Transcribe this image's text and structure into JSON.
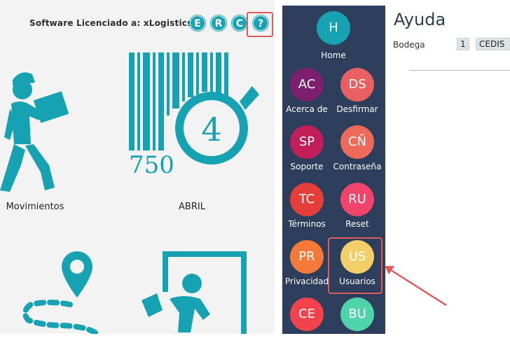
{
  "license_text": "Software Licenciado a: xLogistics",
  "top_buttons": [
    "E",
    "R",
    "C",
    "?"
  ],
  "tiles": [
    {
      "label": "Movimientos",
      "icon": "delivery-man-icon"
    },
    {
      "label": "ABRIL",
      "icon": "barcode-number-icon",
      "barcode_text": "750",
      "number_text": "4"
    },
    {
      "label": "",
      "icon": "route-pin-icon"
    },
    {
      "label": "",
      "icon": "door-person-icon"
    }
  ],
  "sidebar": {
    "home": {
      "initials": "H",
      "label": "Home",
      "color": "#17a2b3"
    },
    "items": [
      {
        "initials": "AC",
        "label": "Acerca de",
        "color": "#7b1f6e"
      },
      {
        "initials": "DS",
        "label": "Desfirmar",
        "color": "#e8605f"
      },
      {
        "initials": "SP",
        "label": "Soporte",
        "color": "#c21e5a"
      },
      {
        "initials": "CÑ",
        "label": "Contraseña",
        "color": "#ed6a5a"
      },
      {
        "initials": "TC",
        "label": "Términos",
        "color": "#e53e39"
      },
      {
        "initials": "RU",
        "label": "Reset",
        "color": "#f0446b"
      },
      {
        "initials": "PR",
        "label": "Privacidad",
        "color": "#f57a3a"
      },
      {
        "initials": "US",
        "label": "Usuarios",
        "color": "#f3cf6a"
      },
      {
        "initials": "CE",
        "label": "",
        "color": "#f2434c"
      },
      {
        "initials": "BU",
        "label": "",
        "color": "#4fd3a9"
      }
    ]
  },
  "right": {
    "title": "Ayuda",
    "field_label": "Bodega",
    "chip_code": "1",
    "chip_name": "CEDIS"
  },
  "colors": {
    "accent": "#17a2b3",
    "sidebar_bg": "#2c3e5c",
    "highlight": "#e05a5a"
  }
}
